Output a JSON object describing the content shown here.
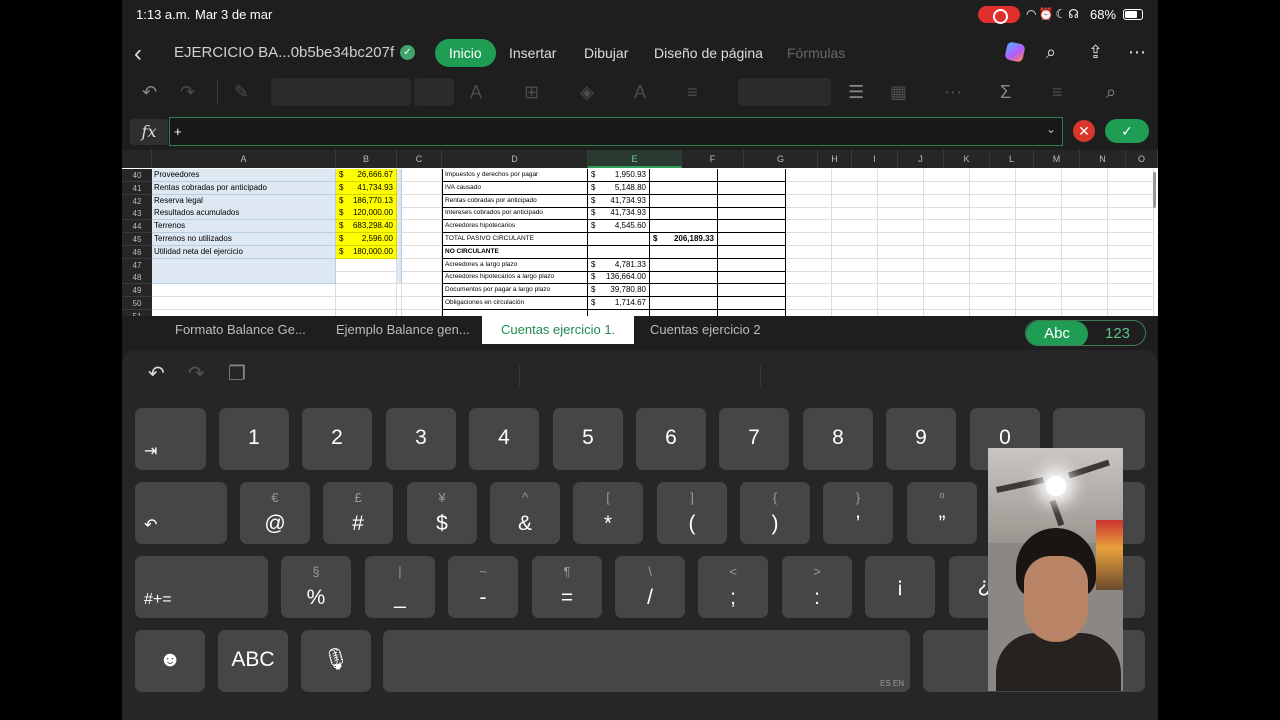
{
  "status": {
    "time": "1:13 a.m.",
    "date": "Mar 3 de mar",
    "battery": "68%"
  },
  "header": {
    "doc_title": "EJERCICIO BA...0b5be34bc207f",
    "tabs": [
      "Inicio",
      "Insertar",
      "Dibujar",
      "Diseño de página",
      "Fórmulas"
    ]
  },
  "formula": {
    "value": "+"
  },
  "grid": {
    "columns": [
      "A",
      "B",
      "C",
      "D",
      "E",
      "F",
      "G",
      "H",
      "I",
      "J",
      "K",
      "L",
      "M",
      "N",
      "O"
    ],
    "rows": [
      {
        "n": "40",
        "a": "Proveedores",
        "b": "26,666.67",
        "d": "Impuestos y derechos por pagar",
        "e": "1,950.93",
        "f": ""
      },
      {
        "n": "41",
        "a": "Rentas cobradas por anticipado",
        "b": "41,734.93",
        "d": "IVA causado",
        "e": "5,148.80",
        "f": ""
      },
      {
        "n": "42",
        "a": "Reserva legal",
        "b": "186,770.13",
        "d": "Rentas cobradas por anticipado",
        "e": "41,734.93",
        "f": ""
      },
      {
        "n": "43",
        "a": "Resultados acumulados",
        "b": "120,000.00",
        "d": "Intereses cobrados por anticipado",
        "e": "41,734.93",
        "f": ""
      },
      {
        "n": "44",
        "a": "Terrenos",
        "b": "683,298.40",
        "d": "Acreedores hipotecarios",
        "e": "4,545.60",
        "f": ""
      },
      {
        "n": "45",
        "a": "Terrenos no utilizados",
        "b": "2,596.00",
        "d": "TOTAL PASIVO CIRCULANTE",
        "e": "",
        "f": "206,189.33"
      },
      {
        "n": "46",
        "a": "Utilidad neta del ejercicio",
        "b": "180,000.00",
        "d": "NO CIRCULANTE",
        "e": "",
        "f": ""
      },
      {
        "n": "47",
        "a": "",
        "b": "",
        "d": "Acreedores a largo plazo",
        "e": "4,781.33",
        "f": ""
      },
      {
        "n": "48",
        "a": "",
        "b": "",
        "d": "Acreedores hipotecarios a  largo plazo",
        "e": "136,664.00",
        "f": ""
      },
      {
        "n": "49",
        "a": "",
        "b": "",
        "d": "Documentos por pagar a largo plazo",
        "e": "39,780.80",
        "f": ""
      },
      {
        "n": "50",
        "a": "",
        "b": "",
        "d": "Obligaciones en circulación",
        "e": "1,714.67",
        "f": ""
      },
      {
        "n": "51",
        "a": "",
        "b": "",
        "d": "",
        "e": "",
        "f": ""
      }
    ],
    "currency": "$"
  },
  "sheets": [
    "Formato Balance Ge...",
    "Ejemplo Balance gen...",
    "Cuentas ejercicio 1.",
    "Cuentas ejercicio 2"
  ],
  "kb_toggle": {
    "abc": "Abc",
    "num": "123"
  },
  "keyboard": {
    "row1": [
      "1",
      "2",
      "3",
      "4",
      "5",
      "6",
      "7",
      "8",
      "9",
      "0"
    ],
    "row2": [
      {
        "sub": "€",
        "main": "@"
      },
      {
        "sub": "£",
        "main": "#"
      },
      {
        "sub": "¥",
        "main": "$"
      },
      {
        "sub": "^",
        "main": "&"
      },
      {
        "sub": "[",
        "main": "*"
      },
      {
        "sub": "]",
        "main": "("
      },
      {
        "sub": "{",
        "main": ")"
      },
      {
        "sub": "}",
        "main": "’"
      },
      {
        "sub": "º",
        "main": "”"
      }
    ],
    "row3": [
      {
        "sub": "§",
        "main": "%"
      },
      {
        "sub": "|",
        "main": "_"
      },
      {
        "sub": "~",
        "main": "-"
      },
      {
        "sub": "¶",
        "main": "="
      },
      {
        "sub": "\\",
        "main": "/"
      },
      {
        "sub": "<",
        "main": ";"
      },
      {
        "sub": ">",
        "main": ":"
      },
      {
        "sub": "",
        "main": "¡"
      },
      {
        "sub": "",
        "main": "¿"
      }
    ],
    "shift_label": "#+=",
    "shift_label_right": "#+=",
    "abc_label": "ABC",
    "space_corner": "ES EN"
  }
}
